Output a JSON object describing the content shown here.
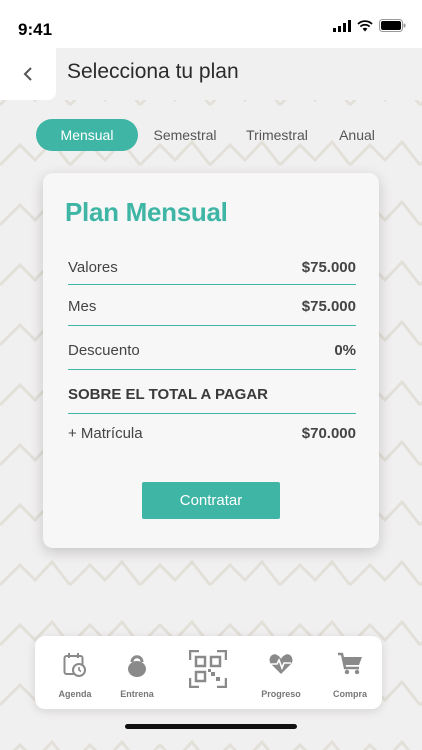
{
  "status_bar": {
    "time": "9:41"
  },
  "header": {
    "title": "Selecciona tu plan"
  },
  "tabs": [
    {
      "label": "Mensual",
      "active": true
    },
    {
      "label": "Semestral",
      "active": false
    },
    {
      "label": "Trimestral",
      "active": false
    },
    {
      "label": "Anual",
      "active": false
    }
  ],
  "plan": {
    "title": "Plan Mensual",
    "rows": [
      {
        "label": "Valores",
        "value": "$75.000"
      },
      {
        "label": "Mes",
        "value": "$75.000"
      },
      {
        "label": "Descuento",
        "value": "0%"
      },
      {
        "label": "SOBRE EL TOTAL A PAGAR",
        "value": ""
      },
      {
        "label": "+ Matrícula",
        "value": "$70.000"
      }
    ],
    "button_label": "Contratar"
  },
  "bottom_nav": [
    {
      "label": "Agenda",
      "icon": "calendar-clock-icon"
    },
    {
      "label": "Entrena",
      "icon": "kettlebell-icon"
    },
    {
      "label": "",
      "icon": "qr-code-icon"
    },
    {
      "label": "Progreso",
      "icon": "heart-pulse-icon"
    },
    {
      "label": "Compra",
      "icon": "cart-icon"
    }
  ],
  "colors": {
    "accent": "#3eb5a5",
    "background": "#f1f0f0",
    "card": "#f7f7f7",
    "nav_icon": "#8a8a8a"
  }
}
